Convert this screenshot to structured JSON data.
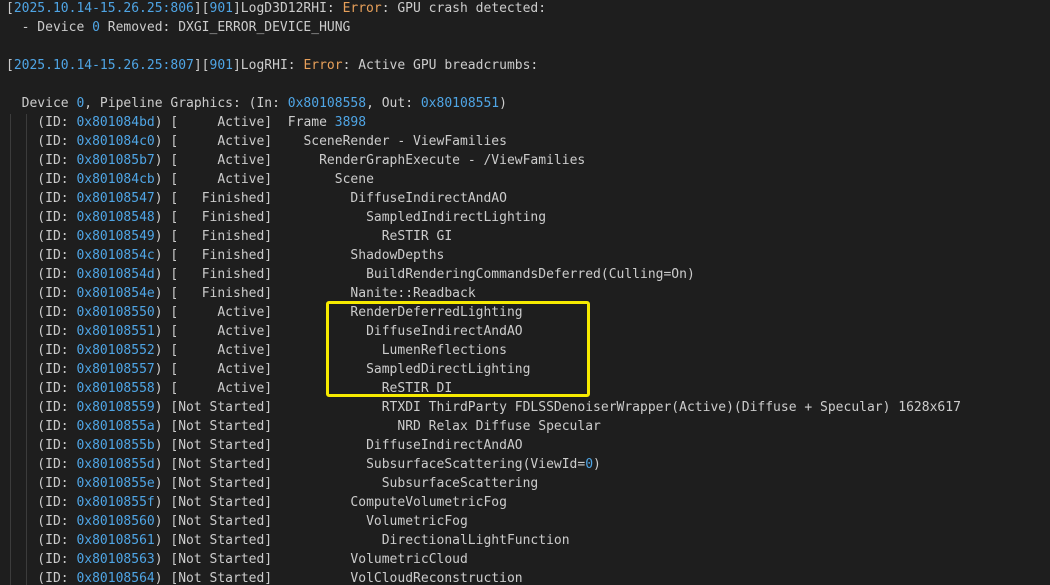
{
  "header_lines": [
    [
      {
        "t": "[",
        "c": "txt"
      },
      {
        "t": "2025.10.14-15.26.25:806",
        "c": "blue"
      },
      {
        "t": "][",
        "c": "txt"
      },
      {
        "t": "901",
        "c": "blue"
      },
      {
        "t": "]LogD3D12RHI: ",
        "c": "txt"
      },
      {
        "t": "Error",
        "c": "err"
      },
      {
        "t": ": GPU crash detected:",
        "c": "txt"
      }
    ],
    [
      {
        "t": "  - Device ",
        "c": "txt"
      },
      {
        "t": "0",
        "c": "blue"
      },
      {
        "t": " Removed: DXGI_ERROR_DEVICE_HUNG",
        "c": "txt"
      }
    ],
    [],
    [
      {
        "t": "[",
        "c": "txt"
      },
      {
        "t": "2025.10.14-15.26.25:807",
        "c": "blue"
      },
      {
        "t": "][",
        "c": "txt"
      },
      {
        "t": "901",
        "c": "blue"
      },
      {
        "t": "]LogRHI: ",
        "c": "txt"
      },
      {
        "t": "Error",
        "c": "err"
      },
      {
        "t": ": Active GPU breadcrumbs:",
        "c": "txt"
      }
    ],
    [],
    [
      {
        "t": "  Device ",
        "c": "txt"
      },
      {
        "t": "0",
        "c": "blue"
      },
      {
        "t": ", Pipeline Graphics: (In: ",
        "c": "txt"
      },
      {
        "t": "0x80108558",
        "c": "blue"
      },
      {
        "t": ", Out: ",
        "c": "txt"
      },
      {
        "t": "0x80108551",
        "c": "blue"
      },
      {
        "t": ")",
        "c": "txt"
      }
    ]
  ],
  "breadcrumbs": [
    {
      "id": "0x801084bd",
      "status": "[     Active]",
      "indent": 0,
      "name": "Frame 3898",
      "name_num": "3898"
    },
    {
      "id": "0x801084c0",
      "status": "[     Active]",
      "indent": 1,
      "name": "SceneRender - ViewFamilies"
    },
    {
      "id": "0x801085b7",
      "status": "[     Active]",
      "indent": 2,
      "name": "RenderGraphExecute - /ViewFamilies"
    },
    {
      "id": "0x801084cb",
      "status": "[     Active]",
      "indent": 3,
      "name": "Scene"
    },
    {
      "id": "0x80108547",
      "status": "[   Finished]",
      "indent": 4,
      "name": "DiffuseIndirectAndAO"
    },
    {
      "id": "0x80108548",
      "status": "[   Finished]",
      "indent": 5,
      "name": "SampledIndirectLighting"
    },
    {
      "id": "0x80108549",
      "status": "[   Finished]",
      "indent": 6,
      "name": "ReSTIR GI"
    },
    {
      "id": "0x8010854c",
      "status": "[   Finished]",
      "indent": 4,
      "name": "ShadowDepths"
    },
    {
      "id": "0x8010854d",
      "status": "[   Finished]",
      "indent": 5,
      "name": "BuildRenderingCommandsDeferred(Culling=On)"
    },
    {
      "id": "0x8010854e",
      "status": "[   Finished]",
      "indent": 4,
      "name": "Nanite::Readback"
    },
    {
      "id": "0x80108550",
      "status": "[     Active]",
      "indent": 4,
      "name": "RenderDeferredLighting"
    },
    {
      "id": "0x80108551",
      "status": "[     Active]",
      "indent": 5,
      "name": "DiffuseIndirectAndAO"
    },
    {
      "id": "0x80108552",
      "status": "[     Active]",
      "indent": 6,
      "name": "LumenReflections"
    },
    {
      "id": "0x80108557",
      "status": "[     Active]",
      "indent": 5,
      "name": "SampledDirectLighting"
    },
    {
      "id": "0x80108558",
      "status": "[     Active]",
      "indent": 6,
      "name": "ReSTIR DI"
    },
    {
      "id": "0x80108559",
      "status": "[Not Started]",
      "indent": 6,
      "name": "RTXDI ThirdParty FDLSSDenoiserWrapper(Active)(Diffuse + Specular) 1628x617"
    },
    {
      "id": "0x8010855a",
      "status": "[Not Started]",
      "indent": 7,
      "name": "NRD Relax Diffuse Specular"
    },
    {
      "id": "0x8010855b",
      "status": "[Not Started]",
      "indent": 5,
      "name": "DiffuseIndirectAndAO"
    },
    {
      "id": "0x8010855d",
      "status": "[Not Started]",
      "indent": 5,
      "name": "SubsurfaceScattering(ViewId=0)",
      "name_num": "0"
    },
    {
      "id": "0x8010855e",
      "status": "[Not Started]",
      "indent": 6,
      "name": "SubsurfaceScattering"
    },
    {
      "id": "0x8010855f",
      "status": "[Not Started]",
      "indent": 4,
      "name": "ComputeVolumetricFog"
    },
    {
      "id": "0x80108560",
      "status": "[Not Started]",
      "indent": 5,
      "name": "VolumetricFog"
    },
    {
      "id": "0x80108561",
      "status": "[Not Started]",
      "indent": 6,
      "name": "DirectionalLightFunction"
    },
    {
      "id": "0x80108563",
      "status": "[Not Started]",
      "indent": 4,
      "name": "VolumetricCloud"
    },
    {
      "id": "0x80108564",
      "status": "[Not Started]",
      "indent": 4,
      "name": "VolCloudReconstruction"
    }
  ],
  "labels": {
    "id_prefix": "    (ID: ",
    "id_suffix": ") "
  },
  "colors": {
    "background": "#1e1e1e",
    "text": "#cccccc",
    "number": "#4fa5e5",
    "error": "#e8a05a",
    "highlight": "#f6ea00"
  }
}
